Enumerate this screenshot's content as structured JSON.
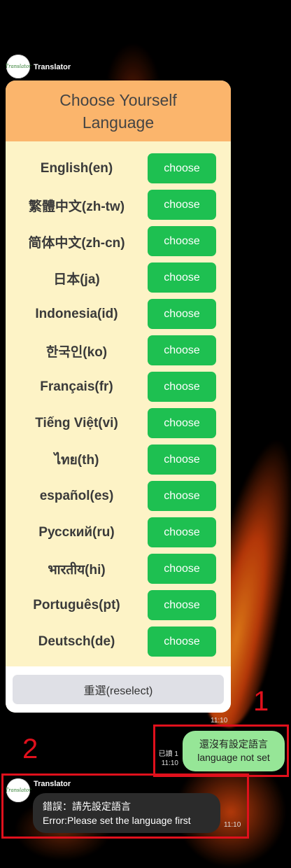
{
  "bot": {
    "name": "Translator",
    "avatar_text": "Translator"
  },
  "card": {
    "title_line1": "Choose Yourself",
    "title_line2": "Language",
    "languages": [
      {
        "name": "English(en)",
        "button": "choose"
      },
      {
        "name": "繁體中文(zh-tw)",
        "button": "choose"
      },
      {
        "name": "简体中文(zh-cn)",
        "button": "choose"
      },
      {
        "name": "日本(ja)",
        "button": "choose"
      },
      {
        "name": "Indonesia(id)",
        "button": "choose"
      },
      {
        "name": "한국인(ko)",
        "button": "choose"
      },
      {
        "name": "Français(fr)",
        "button": "choose"
      },
      {
        "name": "Tiếng Việt(vi)",
        "button": "choose"
      },
      {
        "name": "ไทย(th)",
        "button": "choose"
      },
      {
        "name": "español(es)",
        "button": "choose"
      },
      {
        "name": "Русский(ru)",
        "button": "choose"
      },
      {
        "name": "भारतीय(hi)",
        "button": "choose"
      },
      {
        "name": "Português(pt)",
        "button": "choose"
      },
      {
        "name": "Deutsch(de)",
        "button": "choose"
      }
    ],
    "reselect_label": "重選(reselect)",
    "time": "11:10"
  },
  "annotations": {
    "label1": "1",
    "label2": "2"
  },
  "user_message": {
    "line1": "還沒有設定語言",
    "line2": "language not set",
    "read_status": "已讀 1",
    "time": "11:10"
  },
  "bot_reply": {
    "sender": "Translator",
    "line1": "錯誤：請先設定語言",
    "line2": "Error:Please set the language first",
    "time": "11:10"
  },
  "colors": {
    "header": "#fbb56c",
    "card_bg": "#fdf3c6",
    "choose_button": "#1ec051",
    "user_bubble": "#96e697",
    "bot_bubble": "#2b2b2b",
    "annotation": "#e0101c"
  }
}
